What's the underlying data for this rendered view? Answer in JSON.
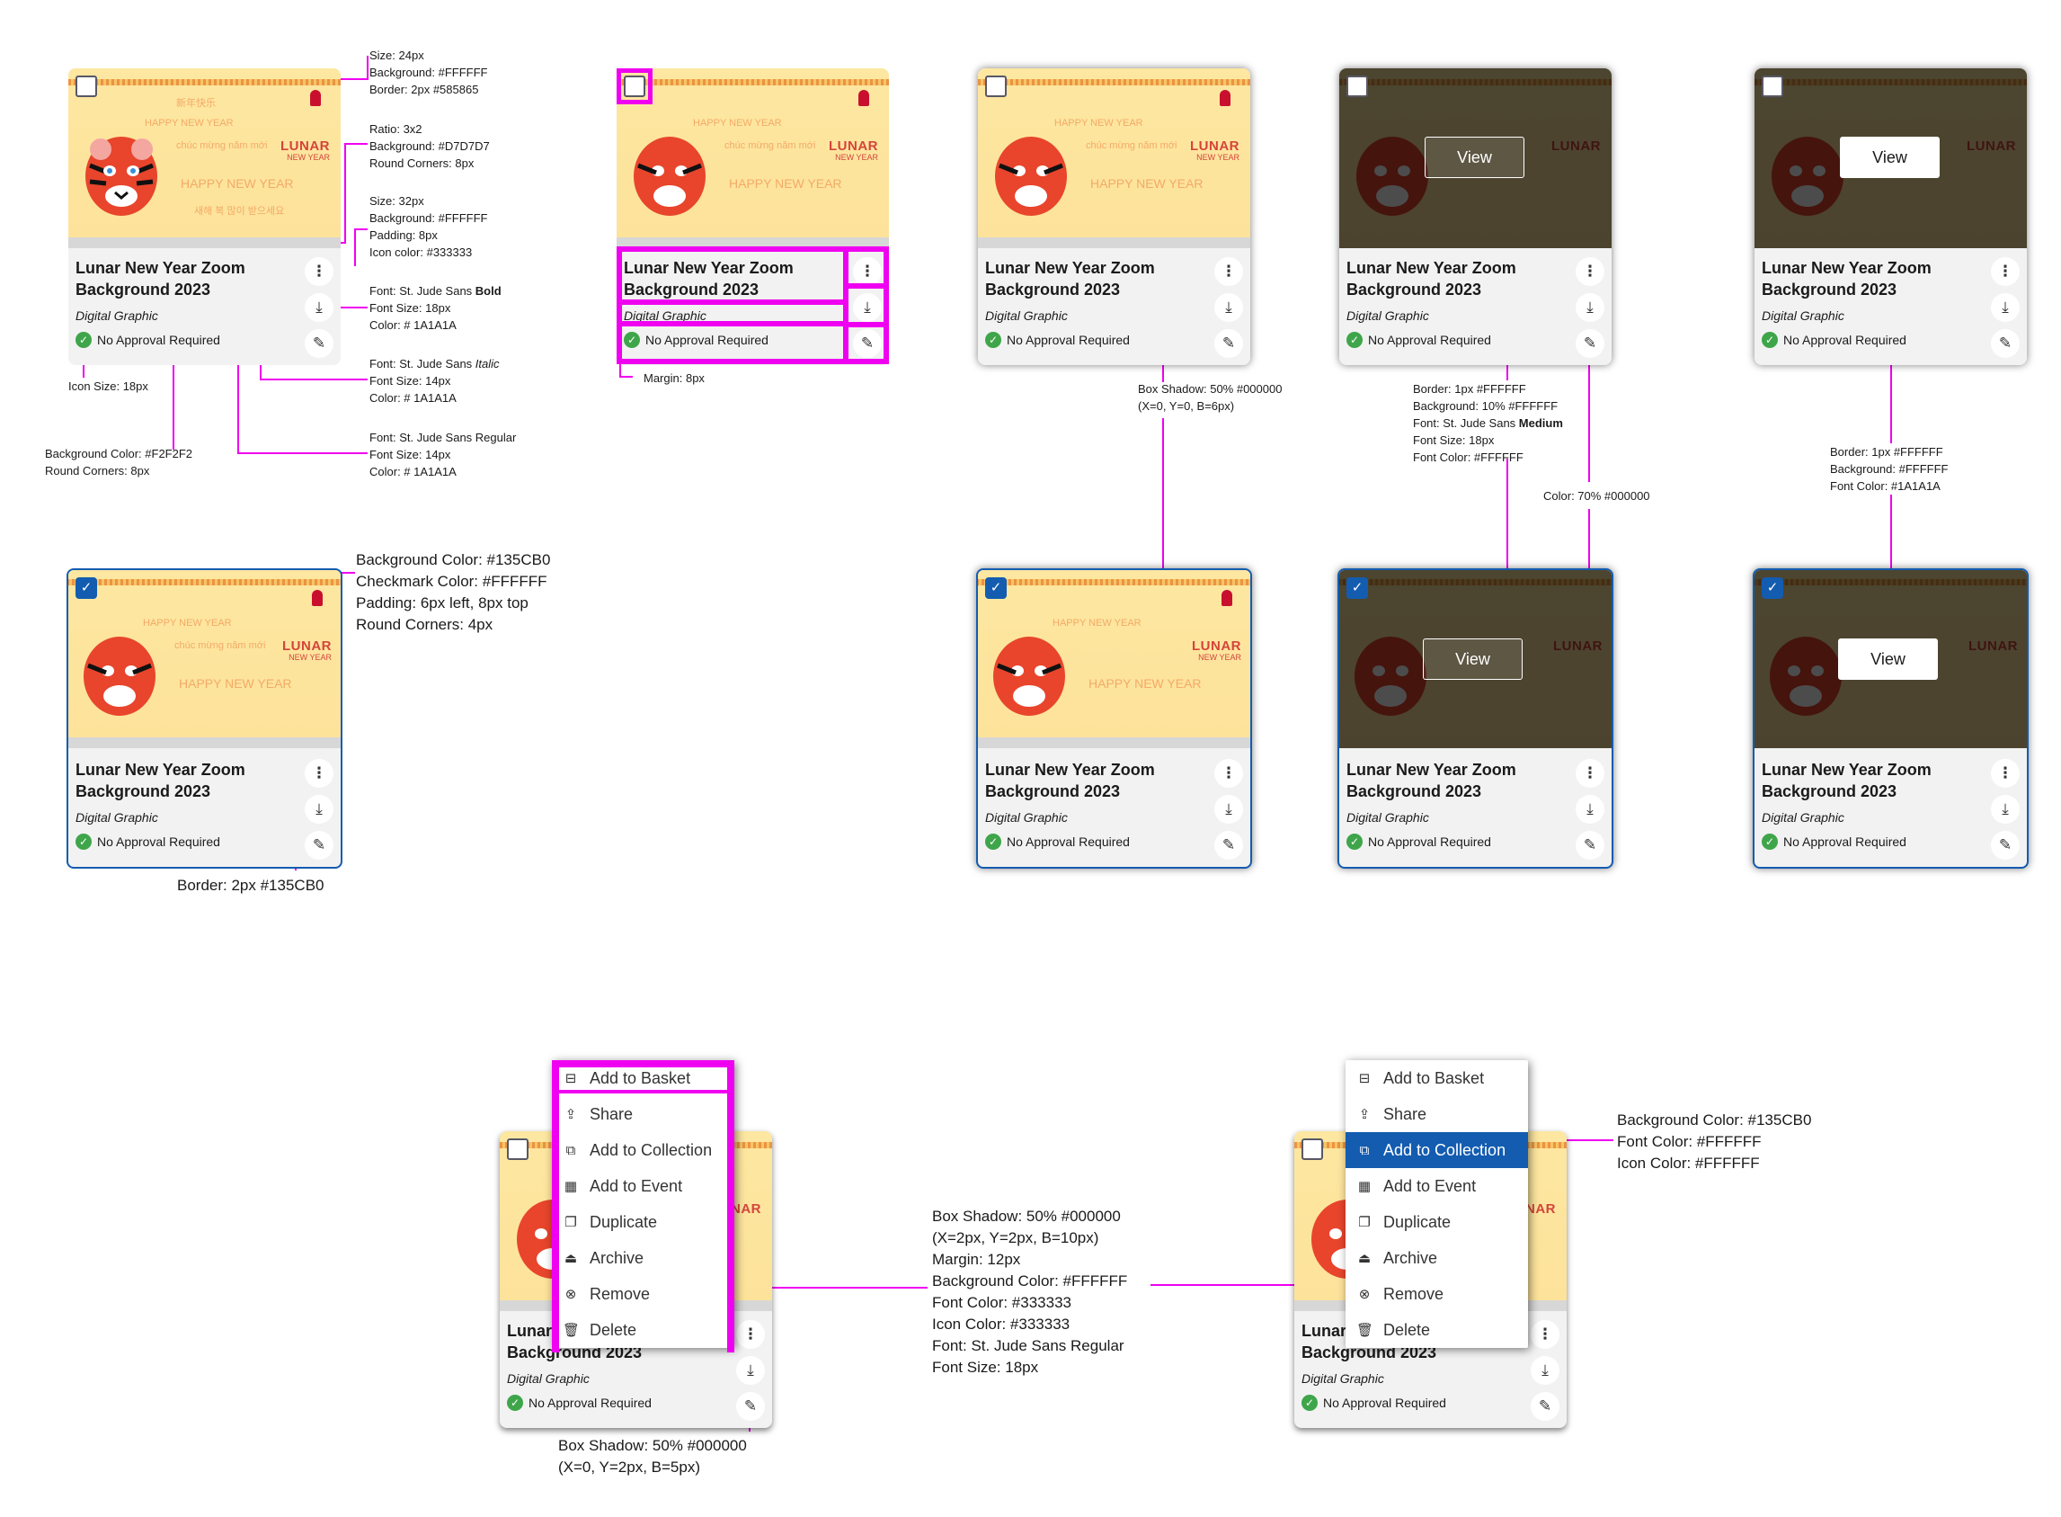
{
  "colors": {
    "accent": "#135CB0",
    "annotation_line": "#F000F0",
    "card_bg": "#F2F2F2"
  },
  "card": {
    "title": "Lunar New Year Zoom Background 2023",
    "subtitle": "Digital Graphic",
    "approval": "No Approval Required",
    "view_label": "View",
    "thumb_text": {
      "lunar": "LUNAR",
      "new_year": "NEW YEAR",
      "happy": "HAPPY NEW YEAR",
      "chuc": "chúc mừng năm mới",
      "korean": "새해 복 많이 받으세요",
      "chinese": "新年快乐"
    },
    "icons": [
      "more-vertical-icon",
      "download-icon",
      "edit-icon",
      "check-circle-icon",
      "checkbox-icon"
    ]
  },
  "menu": {
    "items": [
      {
        "label": "Add to Basket",
        "icon": "basket-icon"
      },
      {
        "label": "Share",
        "icon": "share-icon"
      },
      {
        "label": "Add to Collection",
        "icon": "collection-icon"
      },
      {
        "label": "Add to Event",
        "icon": "calendar-icon"
      },
      {
        "label": "Duplicate",
        "icon": "duplicate-icon"
      },
      {
        "label": "Archive",
        "icon": "archive-icon"
      },
      {
        "label": "Remove",
        "icon": "remove-icon"
      },
      {
        "label": "Delete",
        "icon": "trash-icon"
      }
    ],
    "active_item": "Add to Collection"
  },
  "annotations": {
    "checkbox": [
      "Size: 24px",
      "Background: #FFFFFF",
      "Border: 2px #585865"
    ],
    "thumbnail": [
      "Ratio: 3x2",
      "Background: #D7D7D7",
      "Round Corners: 8px"
    ],
    "icon_button": [
      "Size: 32px",
      "Background: #FFFFFF",
      "Padding: 8px",
      "Icon color: #333333"
    ],
    "title_font": [
      "Font: St. Jude Sans ",
      "Bold",
      "Font Size: 18px",
      "Color: # 1A1A1A"
    ],
    "subtitle_font": [
      "Font: St. Jude Sans ",
      "Italic",
      "Font Size: 14px",
      "Color: # 1A1A1A"
    ],
    "approval_font": [
      "Font: St. Jude Sans Regular",
      "Font Size: 14px",
      "Color: # 1A1A1A"
    ],
    "icon_size": "Icon Size: 18px",
    "card_bg": [
      "Background Color: #F2F2F2",
      "Round Corners: 8px"
    ],
    "margin": "Margin: 8px",
    "hover_shadow": [
      "Box Shadow: 50% #000000",
      "(X=0, Y=0, B=6px)"
    ],
    "view_ghost": [
      "Border: 1px #FFFFFF",
      "Background: 10% #FFFFFF",
      "Font: St. Jude Sans ",
      "Medium",
      "Font Size: 18px",
      "Font Color: #FFFFFF"
    ],
    "overlay_color": "Color: 70% #000000",
    "view_solid": [
      "Border: 1px #FFFFFF",
      "Background: #FFFFFF",
      "Font Color: #1A1A1A"
    ],
    "selected_checkbox": [
      "Background Color: #135CB0",
      "Checkmark Color: #FFFFFF",
      "Padding: 6px left, 8px top",
      "Round Corners: 4px"
    ],
    "selected_border": "Border: 2px #135CB0",
    "menu_spec": [
      "Box Shadow: 50% #000000",
      "(X=2px, Y=2px, B=10px)",
      "Margin: 12px",
      "Background Color: #FFFFFF",
      "Font Color: #333333",
      "Icon Color: #333333",
      "Font: St. Jude Sans Regular",
      "Font Size: 18px"
    ],
    "menu_active": [
      "Background Color: #135CB0",
      "Font Color: #FFFFFF",
      "Icon Color: #FFFFFF"
    ],
    "kebab_shadow": [
      "Box Shadow: 50% #000000",
      "(X=0, Y=2px, B=5px)"
    ]
  }
}
